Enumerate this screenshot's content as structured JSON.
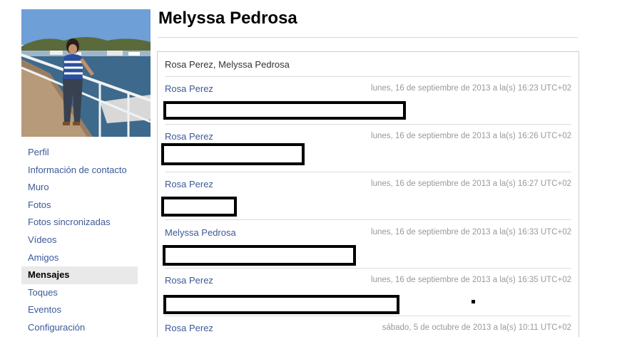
{
  "profile": {
    "name": "Melyssa Pedrosa"
  },
  "sidebar": {
    "items": [
      {
        "label": "Perfil"
      },
      {
        "label": "Información de contacto"
      },
      {
        "label": "Muro"
      },
      {
        "label": "Fotos"
      },
      {
        "label": "Fotos sincronizadas"
      },
      {
        "label": "Vídeos"
      },
      {
        "label": "Amigos"
      },
      {
        "label": "Mensajes",
        "active": true
      },
      {
        "label": "Toques"
      },
      {
        "label": "Eventos"
      },
      {
        "label": "Configuración"
      }
    ]
  },
  "thread": {
    "participants": "Rosa Perez, Melyssa Pedrosa",
    "messages": [
      {
        "author": "Rosa Perez",
        "time": "lunes, 16 de septiembre de 2013 a la(s) 16:23 UTC+02"
      },
      {
        "author": "Rosa Perez",
        "time": "lunes, 16 de septiembre de 2013 a la(s) 16:26 UTC+02"
      },
      {
        "author": "Rosa Perez",
        "time": "lunes, 16 de septiembre de 2013 a la(s) 16:27 UTC+02"
      },
      {
        "author": "Melyssa Pedrosa",
        "time": "lunes, 16 de septiembre de 2013 a la(s) 16:33 UTC+02"
      },
      {
        "author": "Rosa Perez",
        "time": "lunes, 16 de septiembre de 2013 a la(s) 16:35 UTC+02"
      },
      {
        "author": "Rosa Perez",
        "time": "sábado, 5 de octubre de 2013 a la(s) 10:11 UTC+02"
      }
    ]
  },
  "colors": {
    "link": "#3b5998",
    "active_bg": "#e9e9e9"
  }
}
